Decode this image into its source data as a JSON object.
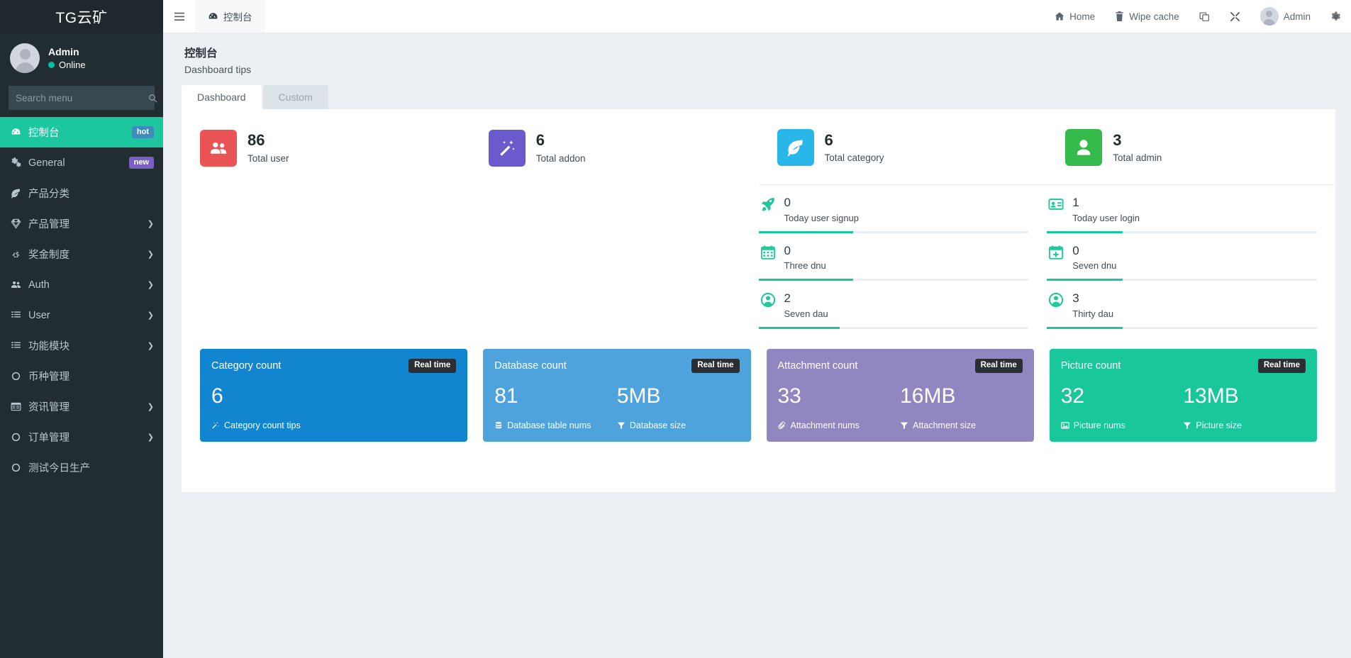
{
  "sidebar": {
    "brand": "TG云矿",
    "user": {
      "name": "Admin",
      "status": "Online"
    },
    "search_placeholder": "Search menu",
    "items": [
      {
        "label": "控制台",
        "icon": "dashboard-icon",
        "badge": "hot",
        "badge_type": "hot",
        "active": true,
        "caret": false
      },
      {
        "label": "General",
        "icon": "cogs-icon",
        "badge": "new",
        "badge_type": "new",
        "active": false,
        "caret": false
      },
      {
        "label": "产品分类",
        "icon": "leaf-icon",
        "badge": "",
        "active": false,
        "caret": false
      },
      {
        "label": "产品管理",
        "icon": "gem-icon",
        "badge": "",
        "active": false,
        "caret": true
      },
      {
        "label": "奖金制度",
        "icon": "recycle-icon",
        "badge": "",
        "active": false,
        "caret": true
      },
      {
        "label": "Auth",
        "icon": "users-icon",
        "badge": "",
        "active": false,
        "caret": true
      },
      {
        "label": "User",
        "icon": "list-icon",
        "badge": "",
        "active": false,
        "caret": true
      },
      {
        "label": "功能模块",
        "icon": "list-icon",
        "badge": "",
        "active": false,
        "caret": true
      },
      {
        "label": "币种管理",
        "icon": "circle-icon",
        "badge": "",
        "active": false,
        "caret": false
      },
      {
        "label": "资讯管理",
        "icon": "table-icon",
        "badge": "",
        "active": false,
        "caret": true
      },
      {
        "label": "订单管理",
        "icon": "circle-icon",
        "badge": "",
        "active": false,
        "caret": true
      },
      {
        "label": "测试今日生产",
        "icon": "circle-icon",
        "badge": "",
        "active": false,
        "caret": false
      }
    ]
  },
  "navbar": {
    "tab_label": "控制台",
    "home": "Home",
    "wipe_cache": "Wipe cache",
    "admin": "Admin"
  },
  "page": {
    "title": "控制台",
    "subtitle": "Dashboard tips",
    "tabs": [
      {
        "label": "Dashboard",
        "active": true
      },
      {
        "label": "Custom",
        "active": false
      }
    ]
  },
  "stats": [
    {
      "value": "86",
      "label": "Total user",
      "color": "#ea5455",
      "icon": "users-icon"
    },
    {
      "value": "6",
      "label": "Total addon",
      "color": "#6a5acd",
      "icon": "magic-wand-icon"
    },
    {
      "value": "6",
      "label": "Total category",
      "color": "#29b6e8",
      "icon": "leaf-icon"
    },
    {
      "value": "3",
      "label": "Total admin",
      "color": "#35bb4b",
      "icon": "user-icon"
    }
  ],
  "ministats": {
    "column1": [
      {
        "value": "0",
        "label": "Today user signup",
        "icon": "rocket-icon",
        "progress": 35
      },
      {
        "value": "0",
        "label": "Three dnu",
        "icon": "calendar-icon",
        "progress": 35
      },
      {
        "value": "2",
        "label": "Seven dau",
        "icon": "user-circle-icon",
        "progress": 30
      }
    ],
    "column2": [
      {
        "value": "1",
        "label": "Today user login",
        "icon": "id-card-icon",
        "progress": 28
      },
      {
        "value": "0",
        "label": "Seven dnu",
        "icon": "calendar-plus-icon",
        "progress": 28
      },
      {
        "value": "3",
        "label": "Thirty dau",
        "icon": "user-circle-icon",
        "progress": 28
      }
    ]
  },
  "count_cards": [
    {
      "title": "Category count",
      "badge": "Real time",
      "color": "#1185d0",
      "value1": "6",
      "value2": "",
      "foot1_label": "Category count tips",
      "foot1_icon": "magic-icon",
      "foot2_label": "",
      "foot2_icon": ""
    },
    {
      "title": "Database count",
      "badge": "Real time",
      "color": "#4fa3dd",
      "value1": "81",
      "value2": "5MB",
      "foot1_label": "Database table nums",
      "foot1_icon": "database-icon",
      "foot2_label": "Database size",
      "foot2_icon": "filter-icon"
    },
    {
      "title": "Attachment count",
      "badge": "Real time",
      "color": "#9186bf",
      "value1": "33",
      "value2": "16MB",
      "foot1_label": "Attachment nums",
      "foot1_icon": "paperclip-icon",
      "foot2_label": "Attachment size",
      "foot2_icon": "filter-icon"
    },
    {
      "title": "Picture count",
      "badge": "Real time",
      "color": "#18c79a",
      "value1": "32",
      "value2": "13MB",
      "foot1_label": "Picture nums",
      "foot1_icon": "image-icon",
      "foot2_label": "Picture size",
      "foot2_icon": "filter-icon"
    }
  ]
}
